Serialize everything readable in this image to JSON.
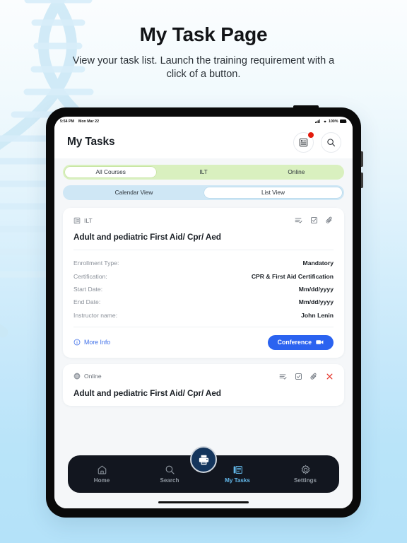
{
  "promo": {
    "title": "My Task Page",
    "subtitle": "View your task list. Launch the training requirement with a click of a button."
  },
  "statusbar": {
    "time": "5:54 PM",
    "date": "Mon Mar 22",
    "battery_pct": "100%",
    "signal_icon": "cellular-signal-icon",
    "wifi_icon": "wifi-icon",
    "battery_icon": "battery-icon"
  },
  "header": {
    "title": "My Tasks",
    "list_button_icon": "list-document-icon",
    "search_button_icon": "search-icon",
    "notification_dot_color": "#e31b0c"
  },
  "filters": {
    "course_type": {
      "track_color": "#d9f0bf",
      "options": [
        {
          "label": "All Courses",
          "active": true
        },
        {
          "label": "ILT",
          "active": false
        },
        {
          "label": "Online",
          "active": false
        }
      ]
    },
    "view_mode": {
      "track_color": "#cfe7f5",
      "options": [
        {
          "label": "Calendar View",
          "active": false
        },
        {
          "label": "List View",
          "active": true
        }
      ]
    }
  },
  "cards": [
    {
      "type_label": "ILT",
      "type_icon": "calendar-list-icon",
      "title": "Adult and pediatric First Aid/ Cpr/ Aed",
      "tools": [
        "list-check-icon",
        "clipboard-check-icon",
        "paperclip-icon"
      ],
      "details": [
        {
          "key": "Enrollment Type:",
          "value": "Mandatory"
        },
        {
          "key": "Certification:",
          "value": "CPR & First Aid Certification"
        },
        {
          "key": "Start Date:",
          "value": "Mm/dd/yyyy"
        },
        {
          "key": "End Date:",
          "value": "Mm/dd/yyyy"
        },
        {
          "key": "Instructor name:",
          "value": "John Lenin"
        }
      ],
      "more_info_label": "More Info",
      "more_info_icon": "info-circle-icon",
      "action_label": "Conference",
      "action_icon": "video-camera-icon",
      "action_color": "#2b63f0"
    },
    {
      "type_label": "Online",
      "type_icon": "globe-icon",
      "title": "Adult and pediatric First Aid/ Cpr/ Aed",
      "tools": [
        "list-check-icon",
        "clipboard-check-icon",
        "paperclip-icon",
        "close-x-icon"
      ],
      "close_color": "#e5342b"
    }
  ],
  "fab": {
    "icon": "printer-icon",
    "background": "#14355c"
  },
  "bottom_nav": {
    "active_color": "#63b8ea",
    "items": [
      {
        "label": "Home",
        "icon": "home-icon",
        "active": false
      },
      {
        "label": "Search",
        "icon": "search-icon",
        "active": false
      },
      {
        "label": "My Tasks",
        "icon": "tasks-document-icon",
        "active": true
      },
      {
        "label": "Settings",
        "icon": "gear-icon",
        "active": false
      }
    ]
  }
}
